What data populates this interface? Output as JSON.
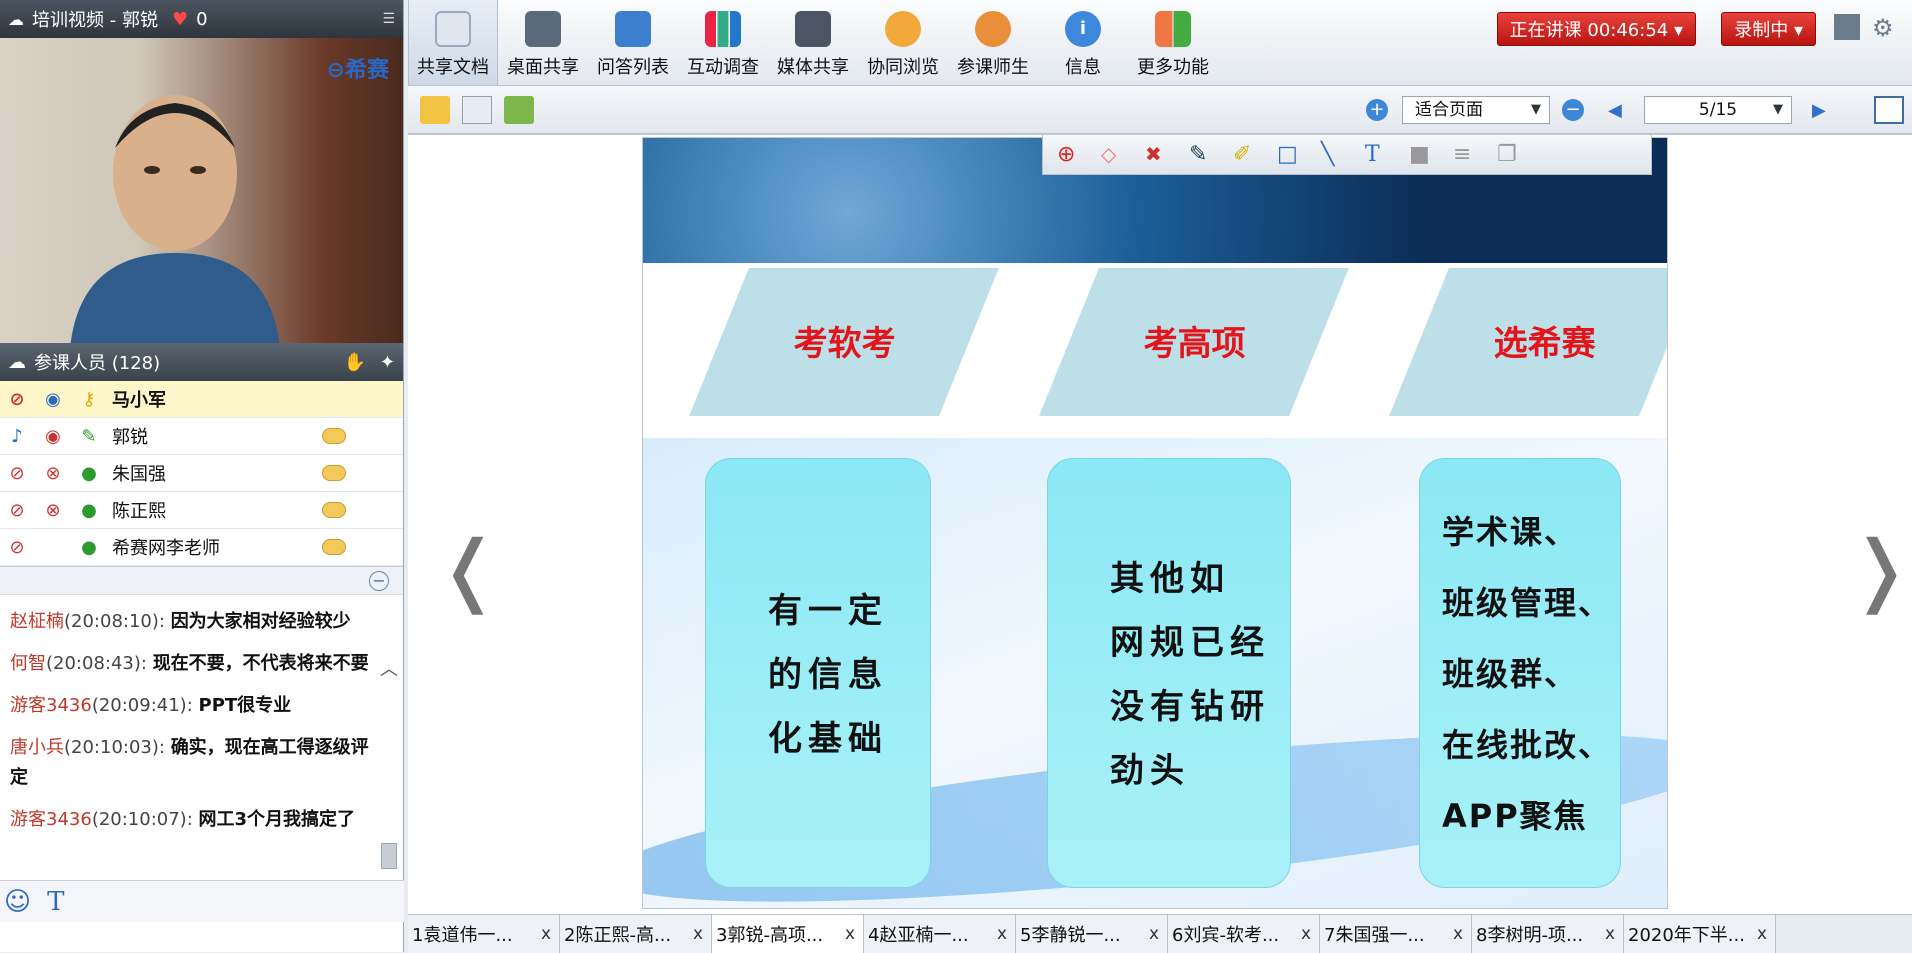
{
  "window": {
    "title": "培训视频 - 郭锐",
    "likes": "0",
    "watermark": "希赛"
  },
  "participants": {
    "header": "参课人员 (128)",
    "rows": [
      {
        "name": "马小军",
        "selected": true
      },
      {
        "name": "郭锐",
        "selected": false
      },
      {
        "name": "朱国强",
        "selected": false
      },
      {
        "name": "陈正熙",
        "selected": false
      },
      {
        "name": "希赛网李老师",
        "selected": false
      }
    ]
  },
  "chat": {
    "messages": [
      {
        "who": "赵柾楠",
        "time": "(20:08:10):",
        "text": "因为大家相对经验较少"
      },
      {
        "who": "何智",
        "time": "(20:08:43):",
        "text": "现在不要，不代表将来不要"
      },
      {
        "who": "游客3436",
        "time": "(20:09:41):",
        "text": "PPT很专业"
      },
      {
        "who": "唐小兵",
        "time": "(20:10:03):",
        "text": "确实，现在高工得逐级评定"
      },
      {
        "who": "游客3436",
        "time": "(20:10:07):",
        "text": "网工3个月我搞定了"
      }
    ]
  },
  "toolbar": {
    "items": [
      "共享文档",
      "桌面共享",
      "问答列表",
      "互动调查",
      "媒体共享",
      "协同浏览",
      "参课师生",
      "信息",
      "更多功能"
    ],
    "live_label": "正在讲课 00:46:54",
    "record_label": "录制中"
  },
  "viewer": {
    "zoom": "适合页面",
    "page": "5/15"
  },
  "slide": {
    "headings": [
      "考软考",
      "考高项",
      "选希赛"
    ],
    "cards": [
      "有一定\n的信息\n化基础",
      "其他如\n网规已经\n没有钻研\n劲头",
      "学术课、\n班级管理、\n班级群、\n在线批改、\nAPP聚焦"
    ]
  },
  "tabs": [
    "1袁道伟一...",
    "2陈正熙-高...",
    "3郭锐-高项...",
    "4赵亚楠一...",
    "5李静锐一...",
    "6刘宾-软考...",
    "7朱国强一...",
    "8李树明-项...",
    "2020年下半..."
  ]
}
